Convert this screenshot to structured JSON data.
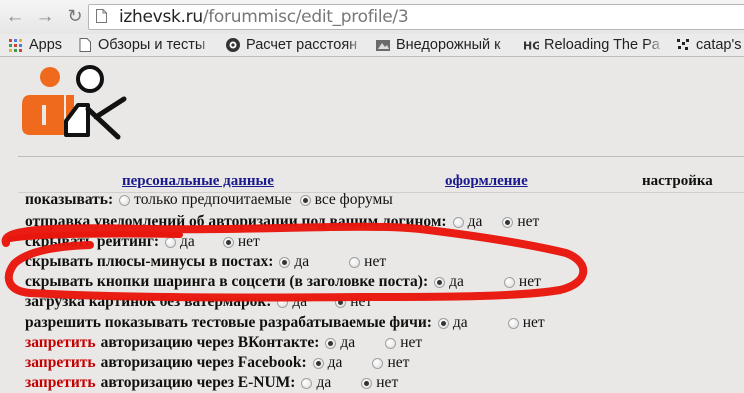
{
  "browser": {
    "url_host": "izhevsk.ru",
    "url_path": "/forummisc/edit_profile/3",
    "bookmarks": [
      {
        "label": "Apps",
        "icon": "apps-grid-icon"
      },
      {
        "label": "Обзоры и тесты",
        "icon": "page-icon"
      },
      {
        "label": "Расчет расстоян",
        "icon": "site-icon"
      },
      {
        "label": "Внедорожный к",
        "icon": "site-icon"
      },
      {
        "label": "Reloading The Pa",
        "icon": "hg-icon"
      },
      {
        "label": "catap's",
        "icon": "site-icon"
      }
    ],
    "hg_text": "HG"
  },
  "tabs": {
    "personal": "персональные данные",
    "design": "оформление",
    "settings": "настройка"
  },
  "settings": [
    {
      "label": "показывать:",
      "warn": "",
      "options": [
        {
          "label": "только предпочитаемые",
          "checked": false
        },
        {
          "label": "все форумы",
          "checked": true
        }
      ]
    },
    {
      "label": "отправка уведомлений об авторизации под вашим логином:",
      "warn": "",
      "options": [
        {
          "label": "да",
          "checked": false
        },
        {
          "label": "нет",
          "checked": true
        }
      ]
    },
    {
      "label": "скрывать рейтинг:",
      "warn": "",
      "options": [
        {
          "label": "да",
          "checked": false
        },
        {
          "label": "нет",
          "checked": true
        }
      ]
    },
    {
      "label": "скрывать плюсы-минусы в постах:",
      "warn": "",
      "options": [
        {
          "label": "да",
          "checked": true
        },
        {
          "label": "нет",
          "checked": false
        }
      ]
    },
    {
      "label": "скрывать кнопки шаринга в соцсети (в заголовке поста):",
      "warn": "",
      "options": [
        {
          "label": "да",
          "checked": true
        },
        {
          "label": "нет",
          "checked": false
        }
      ]
    },
    {
      "label": "загрузка картинок без ватермарок:",
      "warn": "",
      "options": [
        {
          "label": "да",
          "checked": false
        },
        {
          "label": "нет",
          "checked": true
        }
      ]
    },
    {
      "label": "разрешить показывать тестовые разрабатываемые фичи:",
      "warn": "",
      "options": [
        {
          "label": "да",
          "checked": true
        },
        {
          "label": "нет",
          "checked": false
        }
      ]
    },
    {
      "label": "авторизацию через ВКонтакте:",
      "warn": "запретить",
      "options": [
        {
          "label": "да",
          "checked": true
        },
        {
          "label": "нет",
          "checked": false
        }
      ]
    },
    {
      "label": "авторизацию через Facebook:",
      "warn": "запретить",
      "options": [
        {
          "label": "да",
          "checked": true
        },
        {
          "label": "нет",
          "checked": false
        }
      ]
    },
    {
      "label": "авторизацию через E-NUM:",
      "warn": "запретить",
      "options": [
        {
          "label": "да",
          "checked": false
        },
        {
          "label": "нет",
          "checked": true
        }
      ]
    }
  ],
  "colors": {
    "annotation": "#e8160c",
    "logo_orange": "#f06a1e",
    "link": "#1a1a8c",
    "warn": "#c40000"
  }
}
